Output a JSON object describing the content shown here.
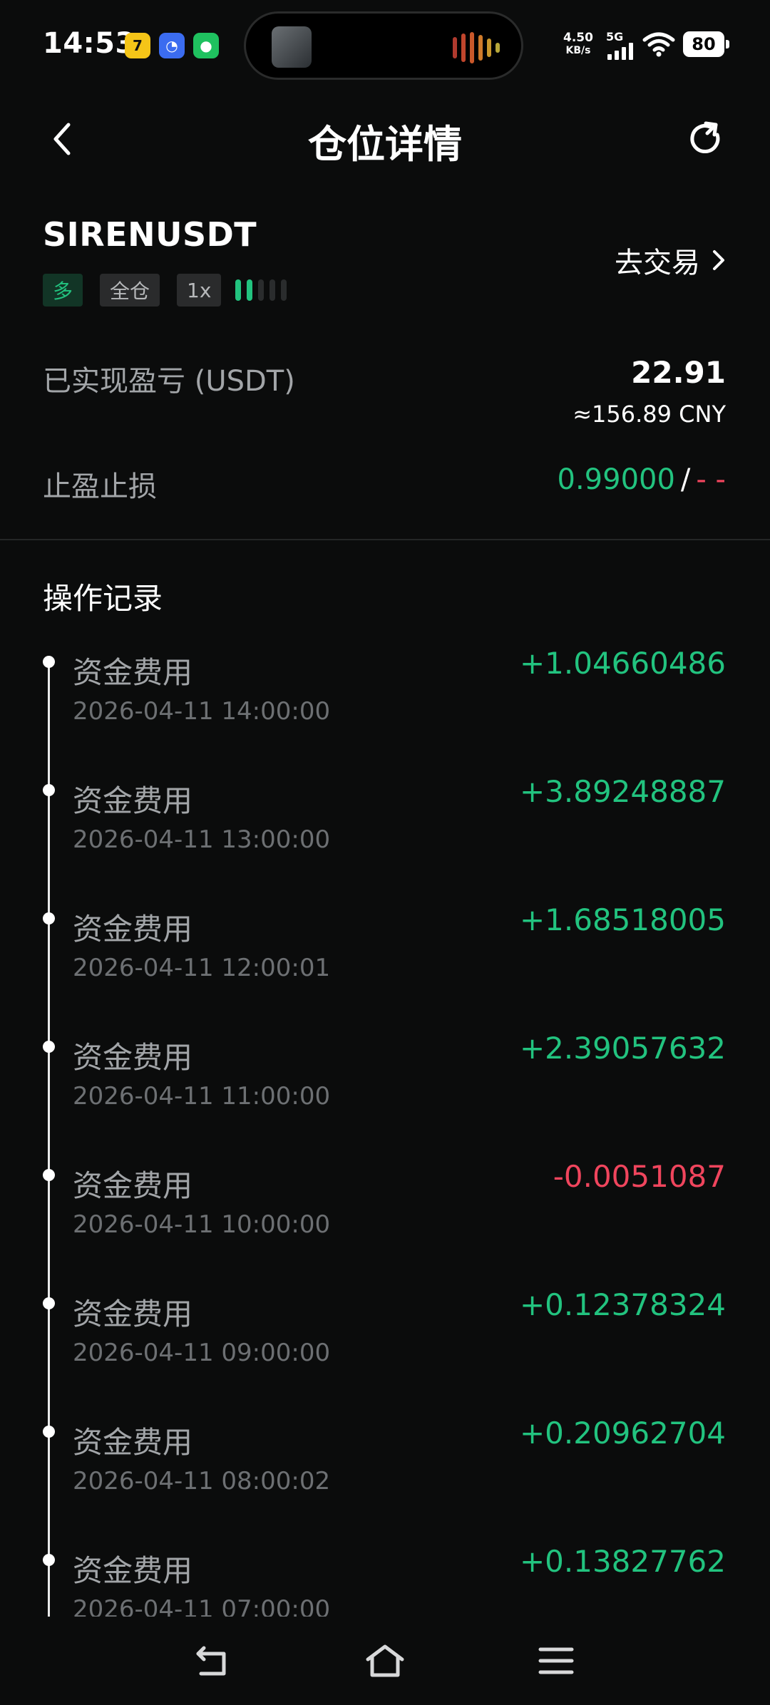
{
  "status_bar": {
    "time": "14:53",
    "net_speed_value": "4.50",
    "net_speed_unit": "KB/s",
    "network_type": "5G",
    "battery": "80"
  },
  "header": {
    "title": "仓位详情"
  },
  "position": {
    "symbol": "SIRENUSDT",
    "side_tag": "多",
    "margin_tag": "全仓",
    "leverage_tag": "1x",
    "trade_link": "去交易",
    "realized_pnl_label": "已实现盈亏 (USDT)",
    "realized_pnl_value": "22.91",
    "realized_pnl_cny": "≈156.89 CNY",
    "tpsl_label": "止盈止损",
    "take_profit": "0.99000",
    "tpsl_separator": "/",
    "stop_loss": "- -"
  },
  "records_section": {
    "title": "操作记录",
    "items": [
      {
        "type": "资金费用",
        "time": "2026-04-11 14:00:00",
        "amount": "+1.04660486",
        "positive": true
      },
      {
        "type": "资金费用",
        "time": "2026-04-11 13:00:00",
        "amount": "+3.89248887",
        "positive": true
      },
      {
        "type": "资金费用",
        "time": "2026-04-11 12:00:01",
        "amount": "+1.68518005",
        "positive": true
      },
      {
        "type": "资金费用",
        "time": "2026-04-11 11:00:00",
        "amount": "+2.39057632",
        "positive": true
      },
      {
        "type": "资金费用",
        "time": "2026-04-11 10:00:00",
        "amount": "-0.0051087",
        "positive": false
      },
      {
        "type": "资金费用",
        "time": "2026-04-11 09:00:00",
        "amount": "+0.12378324",
        "positive": true
      },
      {
        "type": "资金费用",
        "time": "2026-04-11 08:00:02",
        "amount": "+0.20962704",
        "positive": true
      },
      {
        "type": "资金费用",
        "time": "2026-04-11 07:00:00",
        "amount": "+0.13827762",
        "positive": true
      }
    ]
  },
  "colors": {
    "background": "#0b0c0c",
    "positive": "#22c37f",
    "negative": "#f0455d",
    "muted_text": "#a2a5a8"
  },
  "icons": {
    "back": "chevron-left-icon",
    "refresh": "refresh-icon",
    "trade_arrow": "chevron-right-icon",
    "nav_back": "back-arrow-icon",
    "nav_home": "home-icon",
    "nav_menu": "menu-icon"
  }
}
